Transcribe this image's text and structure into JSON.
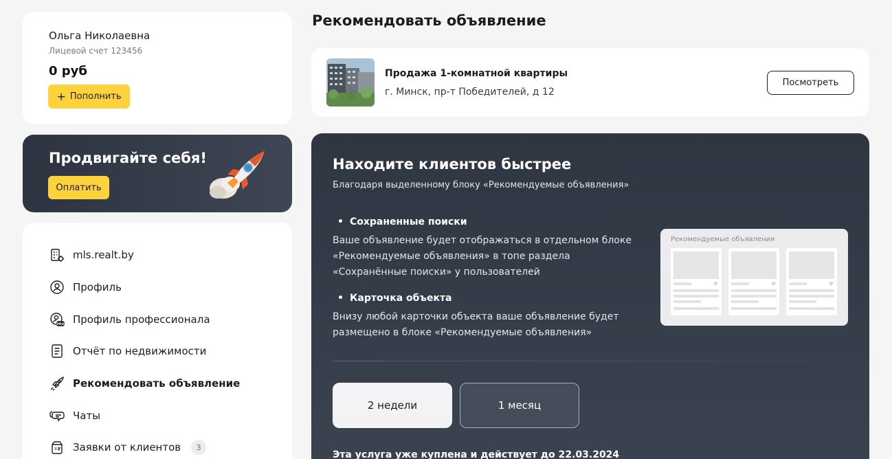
{
  "account": {
    "name": "Ольга Николаевна",
    "account_number": "Лицевой счет 123456",
    "balance": "0 руб",
    "topup_label": "Пополнить",
    "topup_icon": "plus-icon"
  },
  "promo": {
    "title": "Продвигайте себя!",
    "pay_label": "Оплатить",
    "image": "rocket-illustration"
  },
  "nav": {
    "items": [
      {
        "label": "mls.realt.by",
        "icon": "building-gear-icon"
      },
      {
        "label": "Профиль",
        "icon": "user-circle-icon"
      },
      {
        "label": "Профиль профессионала",
        "icon": "user-pro-icon"
      },
      {
        "label": "Отчёт по недвижимости",
        "icon": "document-icon"
      },
      {
        "label": "Рекомендовать объявление",
        "icon": "rocket-icon",
        "active": true
      },
      {
        "label": "Чаты",
        "icon": "chat-icon"
      },
      {
        "label": "Заявки от клиентов",
        "icon": "requests-icon",
        "badge": "3"
      }
    ]
  },
  "main": {
    "title": "Рекомендовать объявление",
    "listing": {
      "title": "Продажа 1-комнатной квартиры",
      "address": "г. Минск, пр-т Победителей, д 12",
      "view_label": "Посмотреть",
      "image": "apartment-building-photo"
    },
    "promo": {
      "title": "Находите клиентов быстрее",
      "subtitle": "Благодаря выделенному блоку «Рекомендуемые объявления»",
      "features": [
        {
          "title": "Сохраненные поиски",
          "description": "Ваше объявление будет отображаться в отдельном блоке «Рекомендуемые объявления» в топе раздела «Сохранённые поиски» у пользователей"
        },
        {
          "title": "Карточка объекта",
          "description": "Внизу любой карточки объекта ваше объявление будет размещено в блоке «Рекомендуемые объявления»"
        }
      ],
      "preview_label": "Рекомендуемые объявления",
      "periods": [
        {
          "label": "2 недели",
          "selected": true
        },
        {
          "label": "1 месяц",
          "selected": false
        }
      ],
      "purchased_text": "Эта услуга уже куплена и действует до 22.03.2024"
    }
  },
  "colors": {
    "accent_yellow": "#fcd33d",
    "dark_panel": "#343b47",
    "background": "#f5f5f6"
  }
}
